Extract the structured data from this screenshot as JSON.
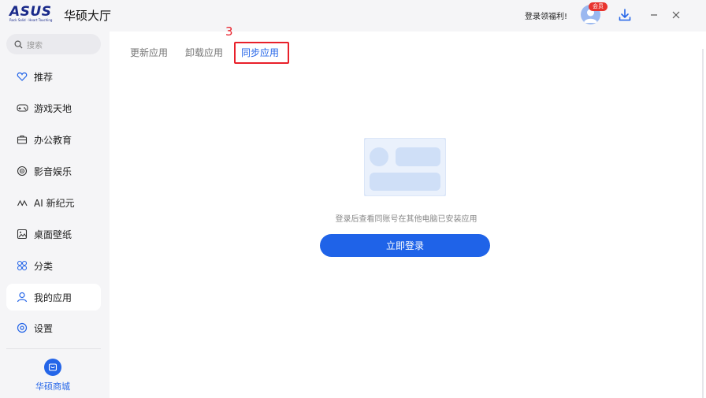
{
  "titlebar": {
    "logo_text": "ASUS",
    "logo_tagline": "Rock Solid · Heart Touching",
    "app_title": "华硕大厅",
    "promo": "登录领福利!",
    "vip_badge": "会员"
  },
  "sidebar": {
    "search_placeholder": "搜索",
    "items": [
      {
        "label": "推荐",
        "icon": "heart-icon"
      },
      {
        "label": "游戏天地",
        "icon": "gamepad-icon"
      },
      {
        "label": "办公教育",
        "icon": "briefcase-icon"
      },
      {
        "label": "影音娱乐",
        "icon": "media-icon"
      },
      {
        "label": "AI 新纪元",
        "icon": "ai-icon"
      },
      {
        "label": "桌面壁纸",
        "icon": "image-icon"
      },
      {
        "label": "分类",
        "icon": "category-icon"
      },
      {
        "label": "我的应用",
        "icon": "user-icon"
      },
      {
        "label": "设置",
        "icon": "settings-icon"
      }
    ],
    "active_item": "我的应用",
    "mall_label": "华硕商城"
  },
  "main": {
    "tabs": [
      {
        "label": "更新应用"
      },
      {
        "label": "卸载应用"
      },
      {
        "label": "同步应用"
      }
    ],
    "active_tab": "同步应用",
    "annotation_number": "3",
    "empty_message": "登录后查看同账号在其他电脑已安装应用",
    "login_button": "立即登录"
  },
  "colors": {
    "accent": "#1f63e8",
    "annotation": "#e8202a",
    "sidebar_bg": "#f5f5f7"
  }
}
